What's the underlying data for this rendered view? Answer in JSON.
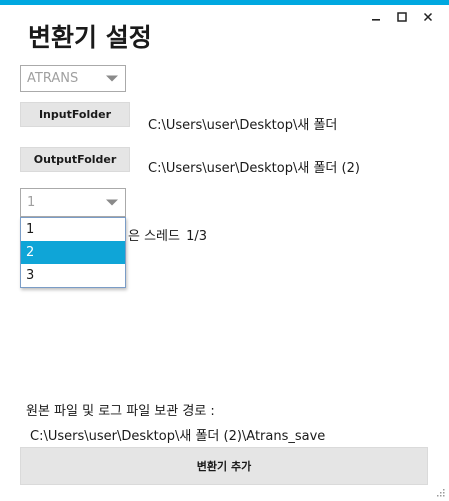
{
  "window": {
    "title": "변환기 설정",
    "accent_color": "#00a8e0",
    "controls": {
      "minimize_icon": "minimize-icon",
      "maximize_icon": "maximize-icon",
      "close_icon": "close-icon"
    }
  },
  "format_select": {
    "value": "ATRANS"
  },
  "input_folder": {
    "button_label": "InputFolder",
    "path": "C:\\Users\\user\\Desktop\\새 폴더"
  },
  "output_folder": {
    "button_label": "OutputFolder",
    "path": "C:\\Users\\user\\Desktop\\새 폴더 (2)"
  },
  "thread_select": {
    "value": "1",
    "label_partial": "은 스레드",
    "count": "1/3",
    "options": [
      "1",
      "2",
      "3"
    ],
    "highlighted_option": "2",
    "highlight_color": "#0fa5d7"
  },
  "save": {
    "label": "원본 파일 및 로그 파일 보관 경로 :",
    "path": "C:\\Users\\user\\Desktop\\새 폴더 (2)\\Atrans_save"
  },
  "actions": {
    "add_converter_label": "변환기 추가"
  }
}
